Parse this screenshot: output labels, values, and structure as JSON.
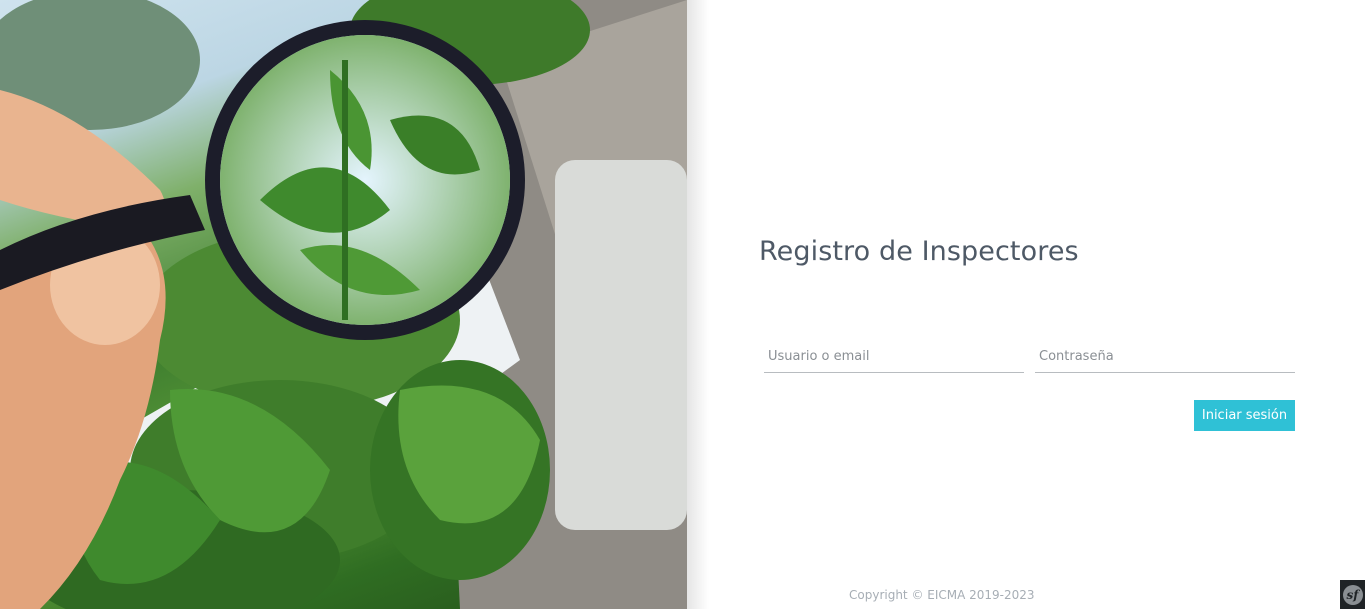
{
  "login": {
    "title": "Registro de Inspectores",
    "username_placeholder": "Usuario o email",
    "password_placeholder": "Contraseña",
    "submit_label": "Iniciar sesión"
  },
  "footer": {
    "copyright": "Copyright © EICMA 2019-2023"
  },
  "debug_toolbar": {
    "label": "sf"
  },
  "colors": {
    "accent": "#2fc1d6",
    "title": "#4e5966",
    "footer_text": "#a7aeb5"
  },
  "hero_image": {
    "icons": [
      "magnifying-glass-icon",
      "plant-leaves"
    ]
  }
}
